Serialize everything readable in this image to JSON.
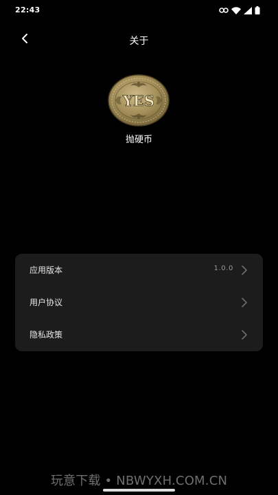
{
  "status_bar": {
    "time": "22:43",
    "icons": [
      "vpn-key-icon",
      "wifi-icon",
      "signal-icon",
      "battery-icon"
    ]
  },
  "nav": {
    "title": "关于",
    "back_icon": "chevron-left-icon"
  },
  "app": {
    "logo_text": "YES",
    "name": "抛硬币"
  },
  "info_card": {
    "items": [
      {
        "label": "应用版本",
        "value": "1.0.0"
      },
      {
        "label": "用户协议",
        "value": ""
      },
      {
        "label": "隐私政策",
        "value": ""
      }
    ]
  },
  "watermark": "玩意下载 • NBWYXH.COM.CN",
  "colors": {
    "background": "#000000",
    "card": "#1c1c1c",
    "coin_gold": "#b39d64",
    "secondary_text": "#9a9a9a"
  }
}
